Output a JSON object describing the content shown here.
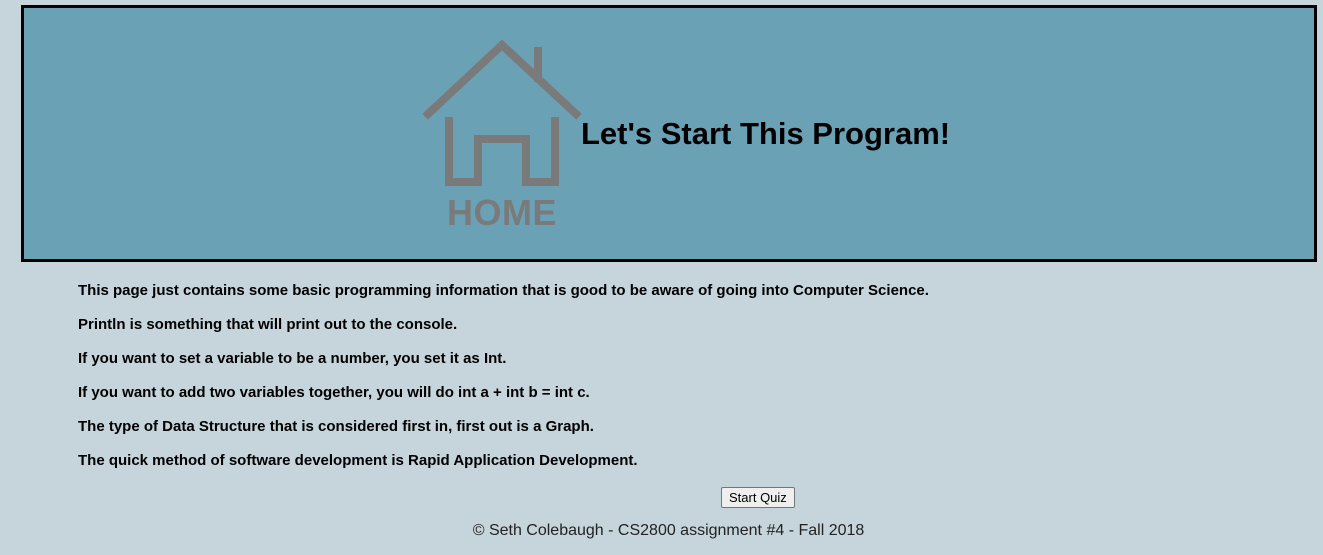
{
  "header": {
    "logo_icon": "home-icon",
    "logo_text": "HOME",
    "title": "Let's Start This Program!"
  },
  "content": {
    "lines": [
      "This page just contains some basic programming information that is good to be aware of going into Computer Science.",
      "Println is something that will print out to the console.",
      "If you want to set a variable to be a number, you set it as Int.",
      "If you want to add two variables together, you will do int a + int b = int c.",
      "The type of Data Structure that is considered first in, first out is a Graph.",
      "The quick method of software development is Rapid Application Development."
    ]
  },
  "actions": {
    "start_quiz_label": "Start Quiz"
  },
  "footer": {
    "text": "© Seth Colebaugh - CS2800 assignment #4 - Fall 2018"
  },
  "colors": {
    "page_background": "#c6d4db",
    "header_background": "#6aa1b4",
    "logo_gray": "#7a7a7a"
  }
}
